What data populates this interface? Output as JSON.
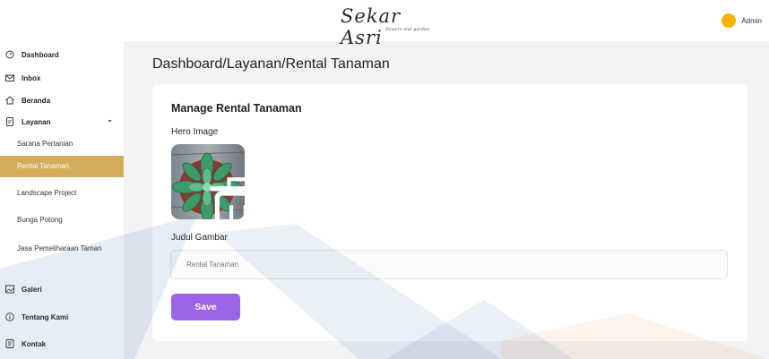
{
  "header": {
    "logo_text": "Sekar Asri",
    "logo_tagline": "flowers and garden",
    "user_name": "Admin"
  },
  "sidebar": {
    "items": [
      {
        "label": "Dashboard",
        "icon": "dashboard-icon"
      },
      {
        "label": "Inbox",
        "icon": "mail-icon"
      },
      {
        "label": "Beranda",
        "icon": "home-icon"
      },
      {
        "label": "Layanan",
        "icon": "document-icon"
      },
      {
        "label": "Galeri",
        "icon": "image-icon"
      },
      {
        "label": "Tentang Kami",
        "icon": "info-icon"
      },
      {
        "label": "Kontak",
        "icon": "contact-icon"
      }
    ],
    "layanan_chevron": "⌄",
    "sub_items": [
      {
        "label": "Sarana Pertanian"
      },
      {
        "label": "Rental Tanaman",
        "active": true
      },
      {
        "label": "Landscape Project"
      },
      {
        "label": "Bunga Potong"
      },
      {
        "label": "Jasa Pemeliharaan Taman"
      }
    ]
  },
  "main": {
    "breadcrumb": "Dashboard/Layanan/Rental Tanaman",
    "card_title": "Manage Rental Tanaman",
    "hero_label": "Hero Image",
    "judul_label": "Judul Gambar",
    "judul_placeholder": "Rental Tanaman",
    "save_label": "Save"
  },
  "colors": {
    "accent": "#d1ad5c",
    "button": "#9b64e6",
    "avatar": "#f4b400",
    "watermark_blue": "#2f6db5",
    "watermark_orange": "#f08a3c"
  }
}
